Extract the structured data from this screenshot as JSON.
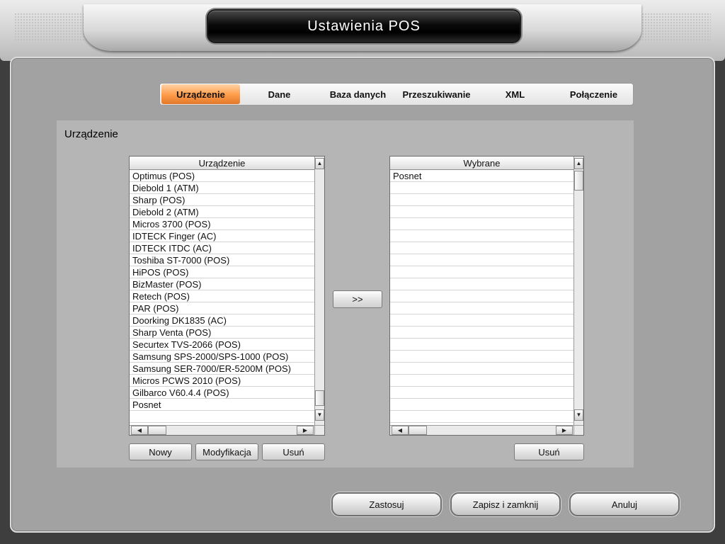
{
  "window": {
    "title": "Ustawienia POS"
  },
  "tabs": [
    {
      "label": "Urządzenie",
      "active": true
    },
    {
      "label": "Dane",
      "active": false
    },
    {
      "label": "Baza danych",
      "active": false
    },
    {
      "label": "Przeszukiwanie",
      "active": false
    },
    {
      "label": "XML",
      "active": false
    },
    {
      "label": "Połączenie",
      "active": false
    }
  ],
  "section": {
    "title": "Urządzenie"
  },
  "device_list": {
    "header": "Urządzenie",
    "items": [
      "Optimus (POS)",
      "Diebold 1 (ATM)",
      "Sharp (POS)",
      "Diebold 2 (ATM)",
      "Micros 3700 (POS)",
      "IDTECK Finger (AC)",
      "IDTECK ITDC (AC)",
      "Toshiba ST-7000 (POS)",
      "HiPOS (POS)",
      "BizMaster (POS)",
      "Retech (POS)",
      "PAR (POS)",
      "Doorking DK1835 (AC)",
      "Sharp Venta (POS)",
      "Securtex TVS-2066 (POS)",
      "Samsung SPS-2000/SPS-1000 (POS)",
      "Samsung SER-7000/ER-5200M (POS)",
      "Micros PCWS 2010 (POS)",
      "Gilbarco V60.4.4 (POS)",
      "Posnet",
      ""
    ],
    "buttons": {
      "new": "Nowy",
      "modify": "Modyfikacja",
      "delete": "Usuń"
    }
  },
  "selected_list": {
    "header": "Wybrane",
    "items": [
      "Posnet",
      "",
      "",
      "",
      "",
      "",
      "",
      "",
      "",
      "",
      "",
      "",
      "",
      "",
      "",
      "",
      "",
      "",
      "",
      "",
      ""
    ],
    "buttons": {
      "delete": "Usuń"
    }
  },
  "transfer_button": ">>",
  "footer": {
    "apply": "Zastosuj",
    "save_close": "Zapisz i zamknij",
    "cancel": "Anuluj"
  },
  "icons": {
    "scroll_up": "▲",
    "scroll_down": "▼",
    "scroll_left": "◀",
    "scroll_right": "▶"
  },
  "colors": {
    "active_tab": "#ff9f4e",
    "panel": "#a2a2a2",
    "content": "#b5b5b5"
  }
}
